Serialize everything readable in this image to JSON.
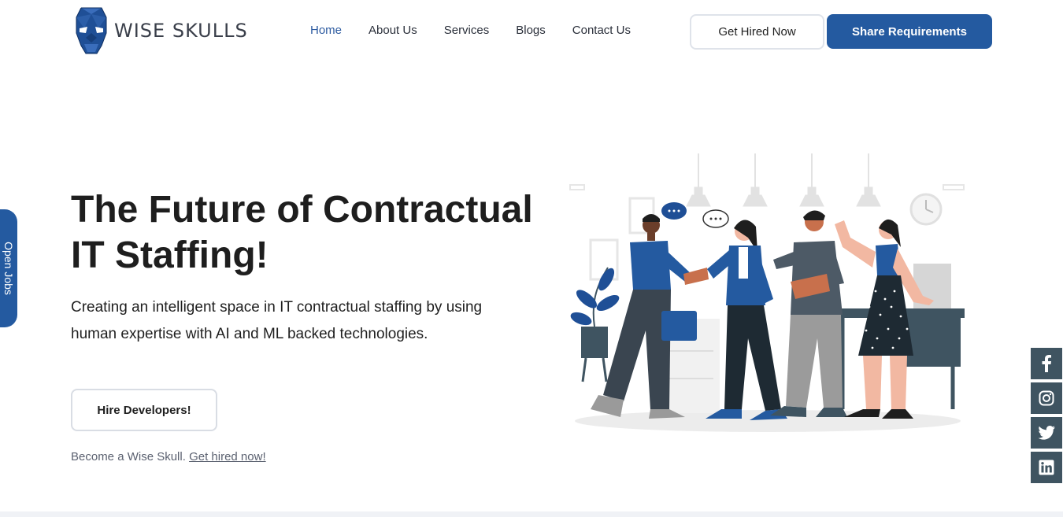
{
  "brand": {
    "name": "WISE SKULLS"
  },
  "nav": {
    "items": [
      {
        "label": "Home",
        "active": true
      },
      {
        "label": "About Us",
        "active": false
      },
      {
        "label": "Services",
        "active": false
      },
      {
        "label": "Blogs",
        "active": false
      },
      {
        "label": "Contact Us",
        "active": false
      }
    ]
  },
  "header_buttons": {
    "get_hired": "Get Hired Now",
    "share_requirements": "Share Requirements"
  },
  "hero": {
    "title_line1": "The Future of Contractual",
    "title_line2": "IT Staffing!",
    "subtitle_line1": "Creating an intelligent space in IT contractual staffing by using",
    "subtitle_line2": "human expertise with AI and ML backed technologies.",
    "cta": "Hire Developers!",
    "become_text": "Become a Wise Skull. ",
    "become_link": "Get hired now!"
  },
  "side_tab": {
    "label": "Open Jobs"
  },
  "social": [
    "facebook-icon",
    "instagram-icon",
    "twitter-icon",
    "linkedin-icon"
  ],
  "colors": {
    "primary": "#245aa0",
    "social_bg": "#3f5461",
    "text": "#1e1e1e"
  }
}
